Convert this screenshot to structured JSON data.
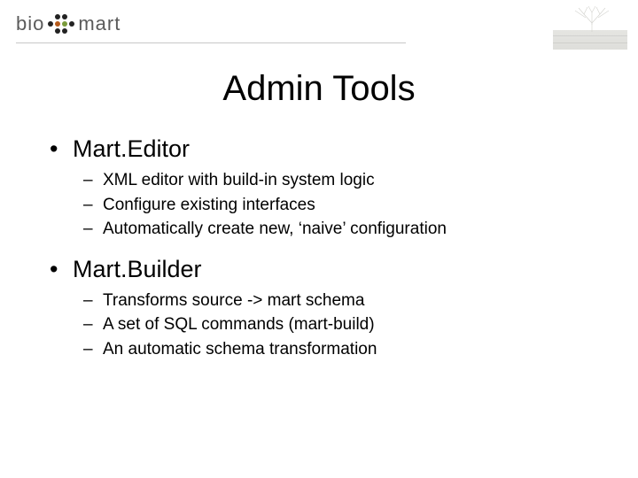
{
  "logo": {
    "part1": "bio",
    "part2": "mart"
  },
  "title": "Admin Tools",
  "sections": [
    {
      "heading": "Mart.Editor",
      "items": [
        "XML editor with build-in system logic",
        "Configure existing interfaces",
        "Automatically create new, ‘naive’ configuration"
      ]
    },
    {
      "heading": "Mart.Builder",
      "items": [
        "Transforms source -> mart schema",
        "A set of SQL commands (mart-build)",
        "An automatic schema transformation"
      ]
    }
  ]
}
